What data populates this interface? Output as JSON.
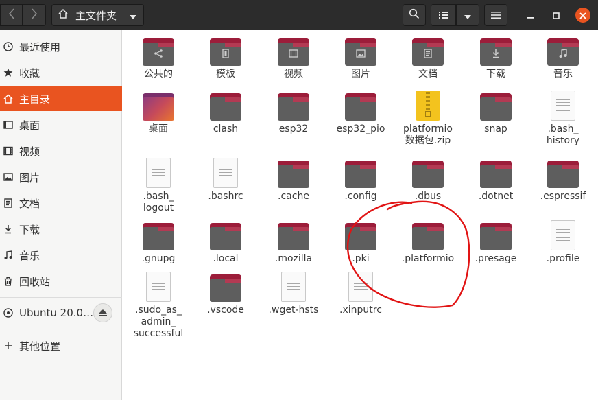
{
  "header": {
    "location_label": "主文件夹"
  },
  "sidebar": {
    "items": [
      {
        "label": "最近使用",
        "icon": "clock-icon"
      },
      {
        "label": "收藏",
        "icon": "star-icon"
      },
      {
        "label": "主目录",
        "icon": "home-icon",
        "active": true
      },
      {
        "label": "桌面",
        "icon": "desktop-icon"
      },
      {
        "label": "视频",
        "icon": "video-icon"
      },
      {
        "label": "图片",
        "icon": "picture-icon"
      },
      {
        "label": "文档",
        "icon": "document-icon"
      },
      {
        "label": "下载",
        "icon": "download-icon"
      },
      {
        "label": "音乐",
        "icon": "music-icon"
      },
      {
        "label": "回收站",
        "icon": "trash-icon"
      }
    ],
    "device": {
      "label": "Ubuntu 20.0…",
      "icon": "disk-icon"
    },
    "other": {
      "label": "其他位置",
      "icon": "plus-icon"
    }
  },
  "files": [
    {
      "name": "公共的",
      "kind": "folder",
      "emblem": "share"
    },
    {
      "name": "模板",
      "kind": "folder",
      "emblem": "template"
    },
    {
      "name": "视频",
      "kind": "folder",
      "emblem": "video"
    },
    {
      "name": "图片",
      "kind": "folder",
      "emblem": "picture"
    },
    {
      "name": "文档",
      "kind": "folder",
      "emblem": "document"
    },
    {
      "name": "下载",
      "kind": "folder",
      "emblem": "download"
    },
    {
      "name": "音乐",
      "kind": "folder",
      "emblem": "music"
    },
    {
      "name": "桌面",
      "kind": "desktop-folder"
    },
    {
      "name": "clash",
      "kind": "folder"
    },
    {
      "name": "esp32",
      "kind": "folder"
    },
    {
      "name": "esp32_pio",
      "kind": "folder"
    },
    {
      "name": "platformio\n数据包.zip",
      "kind": "zip"
    },
    {
      "name": "snap",
      "kind": "folder"
    },
    {
      "name": ".bash_\nhistory",
      "kind": "text"
    },
    {
      "name": ".bash_\nlogout",
      "kind": "text"
    },
    {
      "name": ".bashrc",
      "kind": "text"
    },
    {
      "name": ".cache",
      "kind": "folder"
    },
    {
      "name": ".config",
      "kind": "folder"
    },
    {
      "name": ".dbus",
      "kind": "folder"
    },
    {
      "name": ".dotnet",
      "kind": "folder"
    },
    {
      "name": ".espressif",
      "kind": "folder"
    },
    {
      "name": ".gnupg",
      "kind": "folder"
    },
    {
      "name": ".local",
      "kind": "folder"
    },
    {
      "name": ".mozilla",
      "kind": "folder"
    },
    {
      "name": ".pki",
      "kind": "folder"
    },
    {
      "name": ".platformio",
      "kind": "folder"
    },
    {
      "name": ".presage",
      "kind": "folder"
    },
    {
      "name": ".profile",
      "kind": "text"
    },
    {
      "name": ".sudo_as_\nadmin_\nsuccessful",
      "kind": "text"
    },
    {
      "name": ".vscode",
      "kind": "folder"
    },
    {
      "name": ".wget-hsts",
      "kind": "text"
    },
    {
      "name": ".xinputrc",
      "kind": "text"
    }
  ],
  "colors": {
    "accent": "#e95420",
    "folder_tab": "#9c1d3a",
    "folder_body": "#5e5e5e",
    "annotation": "#e11414"
  }
}
